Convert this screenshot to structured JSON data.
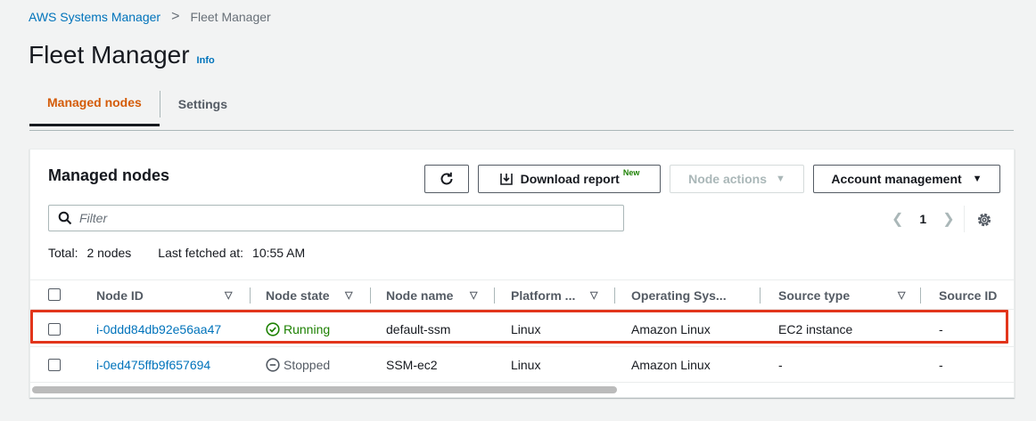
{
  "breadcrumb": {
    "root": "AWS Systems Manager",
    "separator": ">",
    "current": "Fleet Manager"
  },
  "header": {
    "title": "Fleet Manager",
    "info": "Info"
  },
  "tabs": [
    {
      "label": "Managed nodes",
      "active": true
    },
    {
      "label": "Settings",
      "active": false
    }
  ],
  "panel": {
    "title": "Managed nodes",
    "buttons": {
      "refresh_icon": "refresh-icon",
      "download_label": "Download report",
      "download_badge": "New",
      "node_actions_label": "Node actions",
      "account_label": "Account management"
    },
    "filter": {
      "placeholder": "Filter",
      "value": ""
    },
    "pagination": {
      "current_page": "1"
    },
    "summary": {
      "total_label": "Total:",
      "total_value": "2 nodes",
      "fetched_label": "Last fetched at:",
      "fetched_value": "10:55 AM"
    },
    "columns": [
      "Node ID",
      "Node state",
      "Node name",
      "Platform ...",
      "Operating Sys...",
      "Source type",
      "Source ID"
    ],
    "rows": [
      {
        "node_id": "i-0ddd84db92e56aa47",
        "node_state": "Running",
        "node_name": "default-ssm",
        "platform": "Linux",
        "os": "Amazon Linux",
        "source_type": "EC2 instance",
        "source_id": "-"
      },
      {
        "node_id": "i-0ed475ffb9f657694",
        "node_state": "Stopped",
        "node_name": "SSM-ec2",
        "platform": "Linux",
        "os": "Amazon Linux",
        "source_type": "-",
        "source_id": "-"
      }
    ]
  },
  "colors": {
    "link": "#0073bb",
    "active_tab": "#d45b07",
    "running": "#1d8102",
    "highlight": "#e2351b"
  }
}
